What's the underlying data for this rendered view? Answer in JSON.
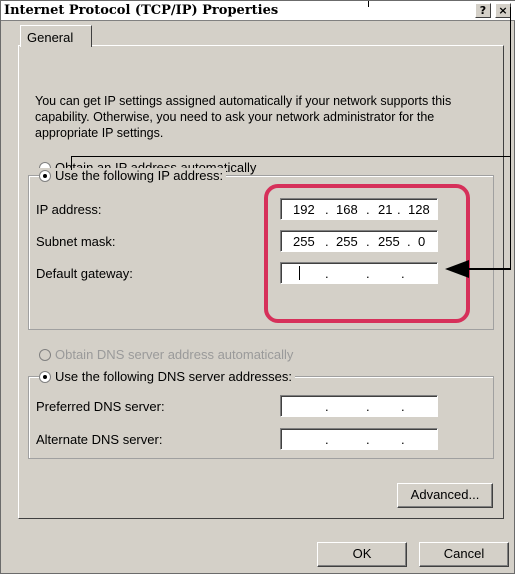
{
  "window": {
    "title": "Internet Protocol (TCP/IP) Properties",
    "help_label": "?",
    "close_label": "×"
  },
  "tabs": [
    {
      "label": "General",
      "selected": true
    }
  ],
  "description": "You can get IP settings assigned automatically if your network supports this capability. Otherwise, you need to ask your network administrator for the appropriate IP settings.",
  "ip_mode": {
    "auto": {
      "label": "Obtain an IP address automatically",
      "selected": false
    },
    "manual": {
      "label": "Use the following IP address:",
      "selected": true
    }
  },
  "ip_fields": [
    {
      "label": "IP address:",
      "octets": [
        "192",
        "168",
        "21",
        "128"
      ]
    },
    {
      "label": "Subnet mask:",
      "octets": [
        "255",
        "255",
        "255",
        "0"
      ]
    },
    {
      "label": "Default gateway:",
      "octets": [
        "",
        "",
        "",
        ""
      ]
    }
  ],
  "dns_mode": {
    "auto": {
      "label": "Obtain DNS server address automatically",
      "selected": false,
      "enabled": false
    },
    "manual": {
      "label": "Use the following DNS server addresses:",
      "selected": true
    }
  },
  "dns_fields": [
    {
      "label": "Preferred DNS server:",
      "octets": [
        "",
        "",
        "",
        ""
      ]
    },
    {
      "label": "Alternate DNS server:",
      "octets": [
        "",
        "",
        "",
        ""
      ]
    }
  ],
  "buttons": {
    "advanced": "Advanced...",
    "ok": "OK",
    "cancel": "Cancel"
  },
  "colors": {
    "highlight": "#d6305a",
    "dialog_face": "#d4d0c8"
  }
}
